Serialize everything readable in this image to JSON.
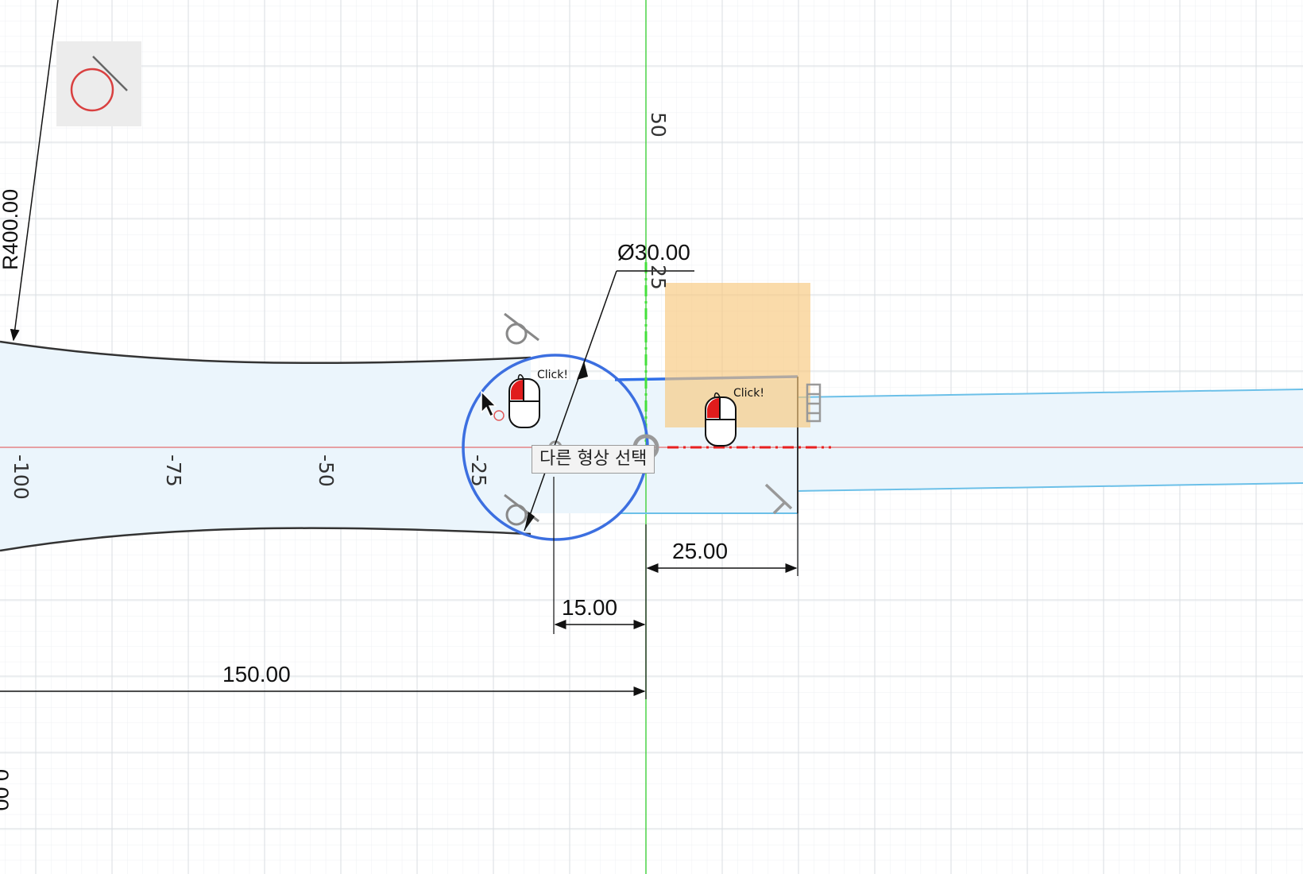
{
  "window": {
    "title": ""
  },
  "sketch": {
    "axis_labels": {
      "x": [
        "-100",
        "-75",
        "-50",
        "-25"
      ],
      "y": [
        "50",
        "25"
      ]
    },
    "dimensions": {
      "radius": "R400.00",
      "diameter": "Ø30.00",
      "width_25": "25.00",
      "width_15": "15.00",
      "width_150": "150.00",
      "partial_bottom_left": "0.00"
    },
    "tooltip": "다른 형상 선택",
    "click_hints": [
      "Click!",
      "Click!"
    ],
    "tool_icon": "circle-tangent-icon"
  },
  "colors": {
    "grid": "#e3e6ea",
    "x_axis": "#e06b6b",
    "y_axis": "#39c234",
    "selected_circle": "#3c6fe0",
    "profile_fill": "#e9f4fb",
    "construction_line": "#66bde6",
    "highlight_box": "#f7cc86",
    "mouse_button": "#e01c1c"
  }
}
